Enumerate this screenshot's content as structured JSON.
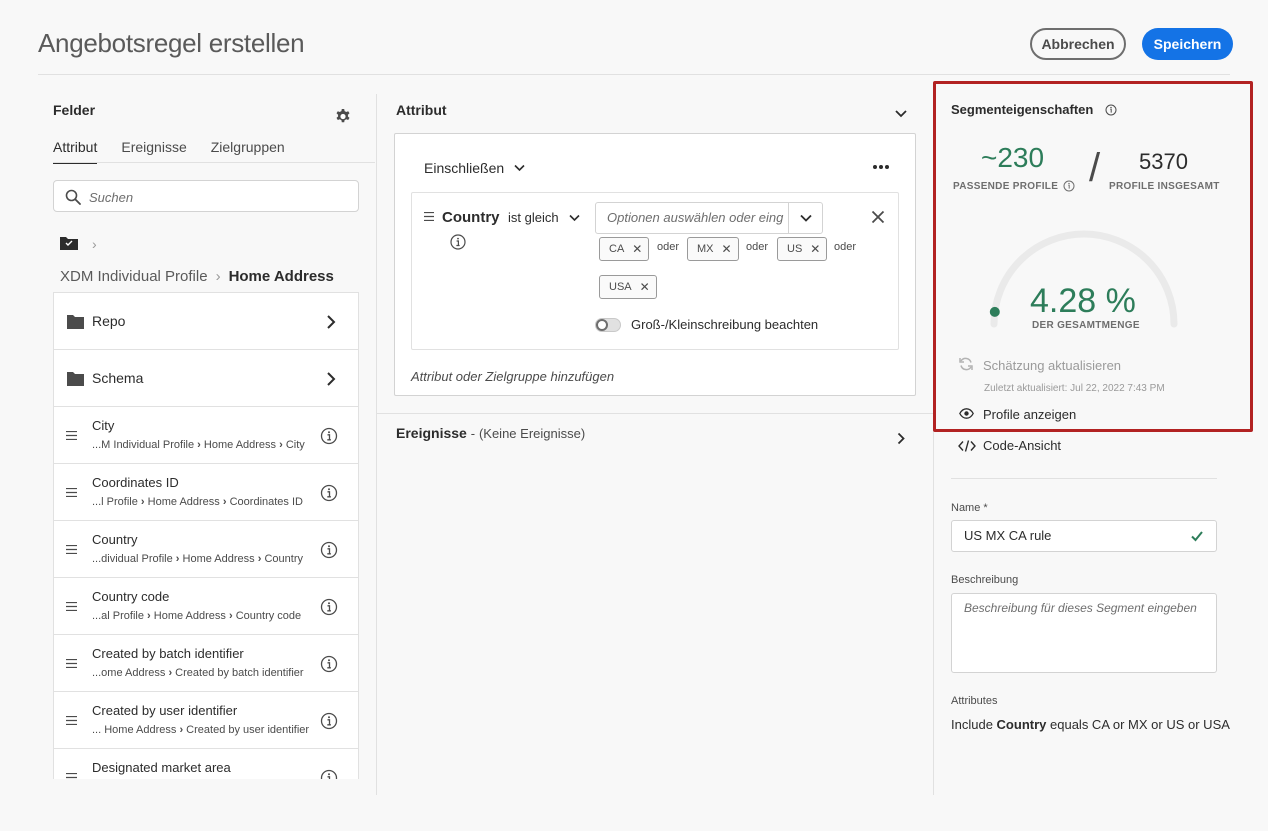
{
  "header": {
    "title": "Angebotsregel erstellen",
    "cancel_label": "Abbrechen",
    "save_label": "Speichern"
  },
  "left": {
    "title": "Felder",
    "tabs": [
      "Attribut",
      "Ereignisse",
      "Zielgruppen"
    ],
    "search_placeholder": "Suchen",
    "path_root": "XDM Individual Profile",
    "path_current": "Home Address",
    "folders": [
      {
        "label": "Repo"
      },
      {
        "label": "Schema"
      }
    ],
    "fields": [
      {
        "label": "City",
        "path_a": "...M Individual Profile",
        "path_b": "Home Address",
        "path_c": "City"
      },
      {
        "label": "Coordinates ID",
        "path_a": "...l Profile",
        "path_b": "Home Address",
        "path_c": "Coordinates ID"
      },
      {
        "label": "Country",
        "path_a": "...dividual Profile",
        "path_b": "Home Address",
        "path_c": "Country"
      },
      {
        "label": "Country code",
        "path_a": "...al Profile",
        "path_b": "Home Address",
        "path_c": "Country code"
      },
      {
        "label": "Created by batch identifier",
        "path_a": "...ome Address",
        "path_b": "Created by batch identifier",
        "path_c": ""
      },
      {
        "label": "Created by user identifier",
        "path_a": "... Home Address",
        "path_b": "Created by user identifier",
        "path_c": ""
      },
      {
        "label": "Designated market area",
        "path_a": "",
        "path_b": "",
        "path_c": ""
      }
    ]
  },
  "middle": {
    "title": "Attribut",
    "include_label": "Einschließen",
    "condition": {
      "field": "Country",
      "operator": "ist gleich",
      "placeholder": "Optionen auswählen oder eing",
      "values": [
        "CA",
        "MX",
        "US",
        "USA"
      ],
      "connector": "oder",
      "case_toggle_label": "Groß-/Kleinschreibung beachten"
    },
    "add_label": "Attribut oder Zielgruppe hinzufügen",
    "events_label": "Ereignisse",
    "events_dash": "-",
    "events_value": "(Keine Ereignisse)"
  },
  "right": {
    "title": "Segmenteigenschaften",
    "matching_value": "~230",
    "matching_caption": "PASSENDE PROFILE",
    "total_value": "5370",
    "total_caption": "PROFILE INSGESAMT",
    "percent_text": "4.28 %",
    "percent_value": 4.28,
    "percent_caption": "DER GESAMTMENGE",
    "refresh_label": "Schätzung aktualisieren",
    "last_updated": "Zuletzt aktualisiert: Jul 22, 2022 7:43 PM",
    "show_profiles_label": "Profile anzeigen",
    "code_view_label": "Code-Ansicht",
    "name_label": "Name *",
    "name_value": "US MX CA rule",
    "desc_label": "Beschreibung",
    "desc_placeholder": "Beschreibung für dieses Segment eingeben",
    "attributes_label": "Attributes",
    "attr_prefix": "Include",
    "attr_field": "Country",
    "attr_suffix": "equals CA or MX or US or USA"
  },
  "colors": {
    "accent": "#1473e6",
    "positive": "#2d7d5a",
    "highlight": "#b22222"
  }
}
